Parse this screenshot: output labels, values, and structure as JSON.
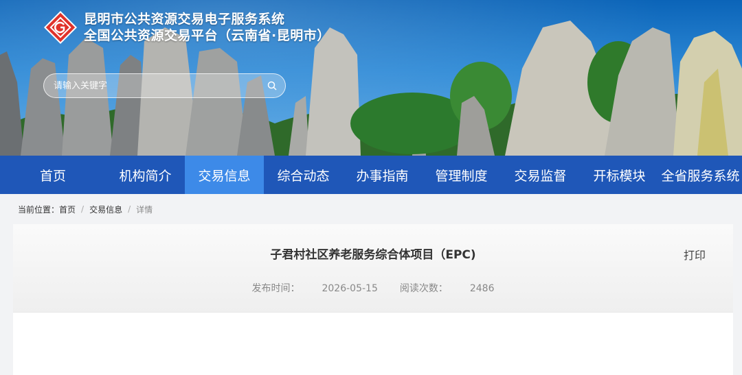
{
  "header": {
    "title_line1": "昆明市公共资源交易电子服务系统",
    "title_line2": "全国公共资源交易平台（云南省·昆明市）",
    "logo_icon": "diamond-g-logo",
    "search_placeholder": "请输入关键字"
  },
  "nav": {
    "items": [
      {
        "label": "首页"
      },
      {
        "label": "机构简介"
      },
      {
        "label": "交易信息",
        "active": true
      },
      {
        "label": "综合动态"
      },
      {
        "label": "办事指南"
      },
      {
        "label": "管理制度"
      },
      {
        "label": "交易监督"
      },
      {
        "label": "开标模块"
      },
      {
        "label": "全省服务系统"
      }
    ]
  },
  "breadcrumb": {
    "prefix": "当前位置：",
    "items": [
      "首页",
      "交易信息",
      "详情"
    ],
    "separator": "/"
  },
  "article": {
    "title": "子君村社区养老服务综合体项目（EPC)",
    "print_label": "打印",
    "publish_label": "发布时间：",
    "publish_date": "2026-05-15",
    "views_label": "阅读次数：",
    "views": "2486"
  },
  "colors": {
    "nav_bg": "#1f57b8",
    "nav_active": "#3d8ae8",
    "logo_red": "#e0322b"
  }
}
